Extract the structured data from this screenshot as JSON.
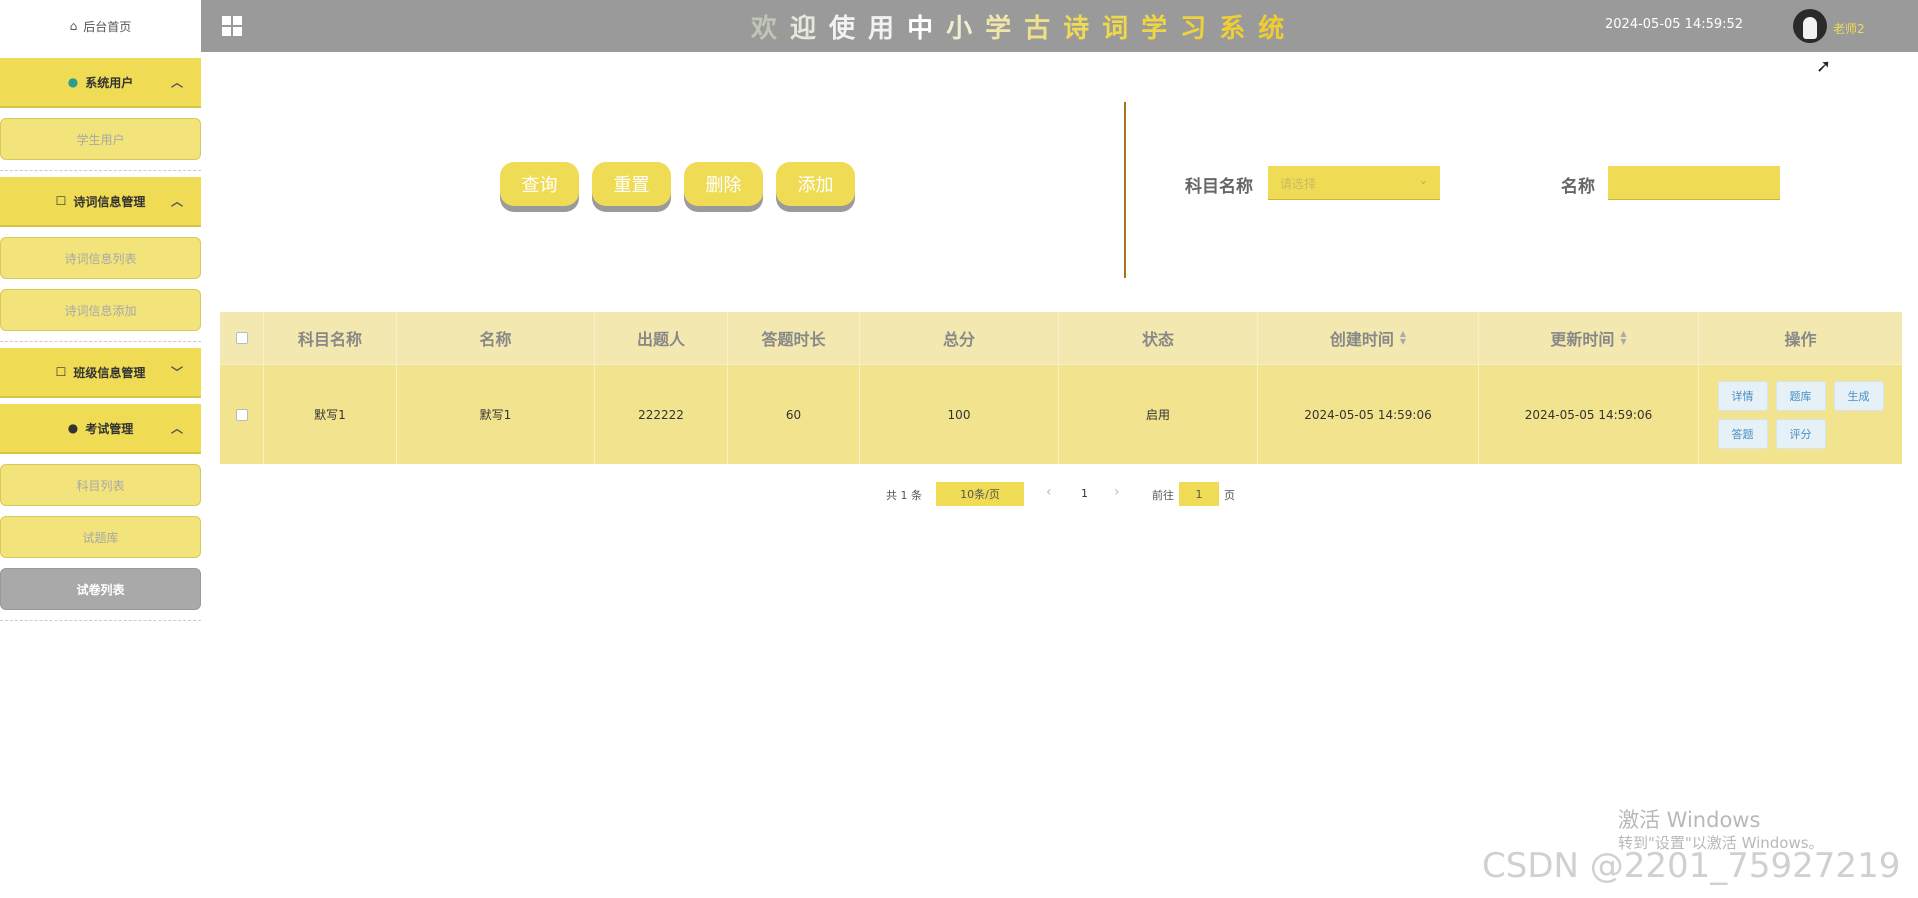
{
  "sidebar": {
    "home": "后台首页",
    "groups": [
      {
        "label": "系统用户",
        "items": [
          "学生用户"
        ]
      },
      {
        "label": "诗词信息管理",
        "items": [
          "诗词信息列表",
          "诗词信息添加"
        ]
      },
      {
        "label": "班级信息管理",
        "items": []
      },
      {
        "label": "考试管理",
        "items": [
          "科目列表",
          "试题库",
          "试卷列表"
        ]
      }
    ]
  },
  "header": {
    "title_chars": [
      "欢",
      "迎",
      "使",
      "用",
      "中",
      "小",
      "学",
      "古",
      "诗",
      "词",
      "学",
      "习",
      "系",
      "统"
    ],
    "title_colors": [
      "#bfc7b4",
      "#e6e8dc",
      "#f2f2f2",
      "#f2f2f2",
      "#ffffff",
      "#f3eecd",
      "#efe6a8",
      "#efe08a",
      "#efdc54",
      "#efd84a",
      "#efd642",
      "#efd23a",
      "#efcf34",
      "#efcc30"
    ],
    "datetime": "2024-05-05 14:59:52",
    "username": "老师2"
  },
  "actions": {
    "query": "查询",
    "reset": "重置",
    "delete": "删除",
    "add": "添加"
  },
  "filters": {
    "subject_label": "科目名称",
    "subject_placeholder": "请选择",
    "name_label": "名称",
    "name_value": ""
  },
  "table": {
    "columns": [
      "科目名称",
      "名称",
      "出题人",
      "答题时长",
      "总分",
      "状态",
      "创建时间",
      "更新时间",
      "操作"
    ],
    "rows": [
      {
        "subject": "默写1",
        "name": "默写1",
        "author": "222222",
        "duration": "60",
        "score": "100",
        "status": "启用",
        "created": "2024-05-05 14:59:06",
        "updated": "2024-05-05 14:59:06",
        "ops": [
          "详情",
          "题库",
          "生成",
          "答题",
          "评分"
        ]
      }
    ]
  },
  "pagination": {
    "total": "共 1 条",
    "page_size": "10条/页",
    "prev": "‹",
    "current": "1",
    "next": "›",
    "goto_prefix": "前往",
    "goto_value": "1",
    "goto_suffix": "页"
  },
  "watermark": {
    "activate_title": "激活 Windows",
    "activate_hint": "转到\"设置\"以激活 Windows。",
    "csdn": "CSDN @2201_75927219"
  },
  "colors": {
    "accent": "#efdc54",
    "header_bg": "#9a9a9a",
    "divider": "#a8731b",
    "active_item": "#a9a9a9"
  }
}
